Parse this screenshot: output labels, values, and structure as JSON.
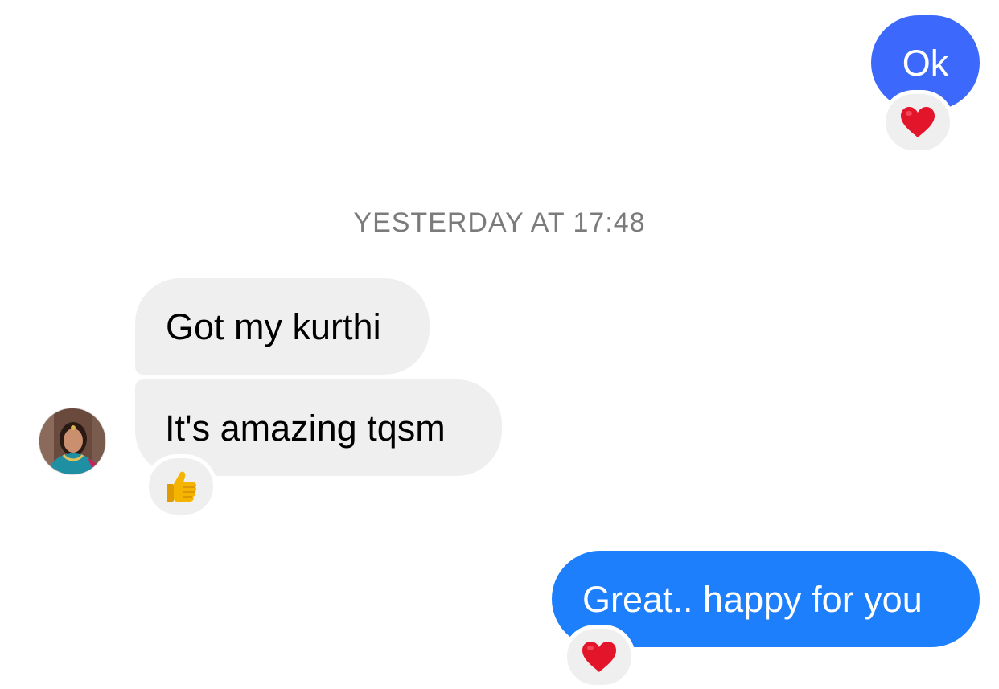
{
  "messages": [
    {
      "id": "ok",
      "direction": "outgoing",
      "text": "Ok",
      "reaction": "red-heart",
      "bubble_color": "#3c69fb"
    },
    {
      "id": "kurthi",
      "direction": "incoming",
      "text": "Got my kurthi",
      "reaction": null,
      "bubble_color": "#efefef"
    },
    {
      "id": "amazing",
      "direction": "incoming",
      "text": "It's amazing tqsm",
      "reaction": "thumbs-up",
      "bubble_color": "#efefef"
    },
    {
      "id": "great",
      "direction": "outgoing",
      "text": "Great.. happy for you",
      "reaction": "red-heart",
      "bubble_color": "#1d7ffb"
    }
  ],
  "timestamp": "YESTERDAY AT 17:48",
  "colors": {
    "outgoing_top": "#3c69fb",
    "outgoing_bottom": "#1d7ffb",
    "incoming": "#efefef",
    "timestamp_text": "#7b7b7b",
    "heart": "#e3152b",
    "thumb": "#f5b400"
  }
}
